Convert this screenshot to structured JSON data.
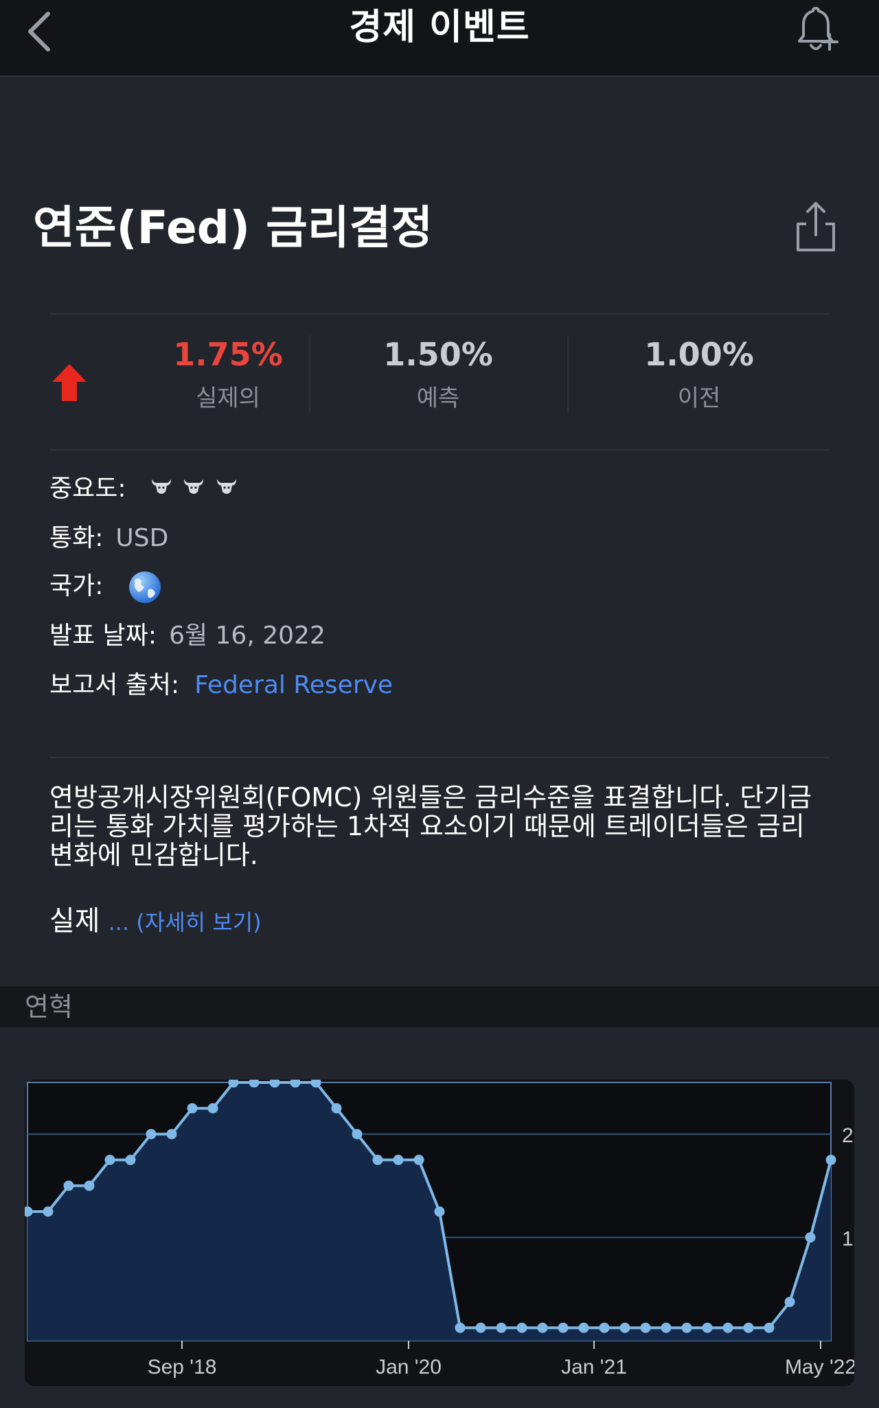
{
  "header": {
    "title": "경제 이벤트",
    "back_icon": "chevron-left-icon",
    "alert_icon": "bell-plus-icon"
  },
  "event": {
    "title": "연준(Fed) 금리결정",
    "share_icon": "share-icon",
    "actual": {
      "value": "1.75%",
      "label": "실제의",
      "color": "#e8463d",
      "trend_icon": "arrow-up-icon"
    },
    "forecast": {
      "value": "1.50%",
      "label": "예측"
    },
    "previous": {
      "value": "1.00%",
      "label": "이전"
    }
  },
  "details": {
    "importance_label": "중요도:",
    "importance_level": 3,
    "importance_icon": "bull-icon",
    "currency_label": "통화:",
    "currency_value": "USD",
    "country_label": "국가:",
    "country_icon": "globe-icon",
    "date_label": "발표 날짜:",
    "date_value": "6월 16, 2022",
    "source_label": "보고서 출처:",
    "source_value": "Federal Reserve"
  },
  "description": {
    "text": "연방공개시장위원회(FOMC) 위원들은 금리수준을 표결합니다. 단기금리는 통화 가치를 평가하는 1차적 요소이기 때문에 트레이더들은 금리 변화에 민감합니다.",
    "more_prefix": "실제",
    "more_link": "... (자세히 보기)"
  },
  "history": {
    "label": "연혁"
  },
  "colors": {
    "accent_link": "#4d8cf5",
    "chart_line": "#7fb8e6",
    "chart_fill": "#14294a",
    "background": "#22252b"
  },
  "chart_data": {
    "type": "area",
    "x_tick_labels": [
      "Sep '18",
      "Jan '20",
      "Jan '21",
      "May '22"
    ],
    "y_tick_labels": [
      "1",
      "2"
    ],
    "ylim": [
      0,
      2.5
    ],
    "grid": true,
    "axis_side": "right",
    "series": [
      {
        "values": [
          1.25,
          1.25,
          1.5,
          1.5,
          1.75,
          1.75,
          2.0,
          2.0,
          2.25,
          2.25,
          2.5,
          2.5,
          2.5,
          2.5,
          2.5,
          2.25,
          2.0,
          1.75,
          1.75,
          1.75,
          1.25,
          0.125,
          0.125,
          0.125,
          0.125,
          0.125,
          0.125,
          0.125,
          0.125,
          0.125,
          0.125,
          0.125,
          0.125,
          0.125,
          0.125,
          0.125,
          0.125,
          0.375,
          1.0,
          1.75
        ]
      }
    ]
  }
}
